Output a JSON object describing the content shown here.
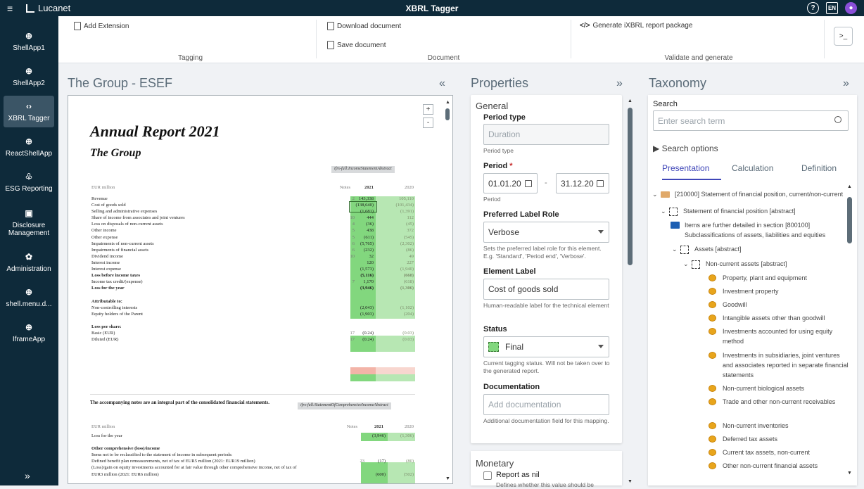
{
  "app": {
    "brand": "Lucanet",
    "title": "XBRL Tagger",
    "help_icon": "?",
    "lang_badge": "EN"
  },
  "sidebar": {
    "items": [
      {
        "label": "ShellApp1",
        "icon": "globe-icon",
        "glyph": "⊕"
      },
      {
        "label": "ShellApp2",
        "icon": "globe-icon",
        "glyph": "⊕"
      },
      {
        "label": "XBRL Tagger",
        "icon": "code-icon",
        "glyph": "‹›"
      },
      {
        "label": "ReactShellApp",
        "icon": "globe-icon",
        "glyph": "⊕"
      },
      {
        "label": "ESG Reporting",
        "icon": "leaf-icon",
        "glyph": "♧"
      },
      {
        "label": "Disclosure Management",
        "icon": "document-icon",
        "glyph": "▣"
      },
      {
        "label": "Administration",
        "icon": "gear-icon",
        "glyph": "✿"
      },
      {
        "label": "shell.menu.d...",
        "icon": "globe-icon",
        "glyph": "⊕"
      },
      {
        "label": "IframeApp",
        "icon": "globe-icon",
        "glyph": "⊕"
      }
    ],
    "active_index": 2,
    "expand_glyph": "»"
  },
  "toolbar": {
    "add_extension": "Add Extension",
    "download_document": "Download document",
    "save_document": "Save document",
    "generate_package": "Generate iXBRL report package",
    "groups": {
      "tagging": "Tagging",
      "document": "Document",
      "validate": "Validate and generate"
    },
    "terminal_glyph": ">_"
  },
  "document_panel": {
    "title": "The Group - ESEF",
    "collapse_glyph": "«",
    "zoom_in": "+",
    "zoom_out": "-",
    "heading": "Annual Report 2021",
    "subheading": "The Group",
    "tag1": "ifrs-full:IncomeStatementAbstract",
    "tag2": "ifrs-full:StatementOfComprehensiveIncomeAbstract",
    "footnote": "The accompanying notes are an integral part of the consolidated financial statements.",
    "table1": {
      "header": {
        "label": "EUR million",
        "notes": "Notes",
        "y1": "2021",
        "y2": "2020"
      },
      "rows": [
        {
          "label": "Revenue",
          "note": "2",
          "v1": "143,338",
          "v2": "105,110",
          "bold": false
        },
        {
          "label": "Cost of goods sold",
          "note": "",
          "v1": "(138,640)",
          "v2": "(101,434)",
          "bold": false
        },
        {
          "label": "Selling and administrative expenses",
          "note": "",
          "v1": "(1,681)",
          "v2": "(1,391)",
          "bold": false
        },
        {
          "label": "Share of income from associates and joint ventures",
          "note": "10",
          "v1": "444",
          "v2": "112",
          "bold": false
        },
        {
          "label": "Loss on disposals of non-current assets",
          "note": "4",
          "v1": "(36)",
          "v2": "(45)",
          "bold": false
        },
        {
          "label": "Other income",
          "note": "5",
          "v1": "438",
          "v2": "372",
          "bold": false
        },
        {
          "label": "Other expense",
          "note": "5",
          "v1": "(611)",
          "v2": "(545)",
          "bold": false
        },
        {
          "label": "Impairments of non-current assets",
          "note": "6",
          "v1": "(5,765)",
          "v2": "(2,302)",
          "bold": false
        },
        {
          "label": "Impairments of financial assets",
          "note": "6",
          "v1": "(232)",
          "v2": "(86)",
          "bold": false
        },
        {
          "label": "Dividend income",
          "note": "10",
          "v1": "32",
          "v2": "49",
          "bold": false
        },
        {
          "label": "Interest income",
          "note": "",
          "v1": "120",
          "v2": "227",
          "bold": false
        },
        {
          "label": "Interest expense",
          "note": "",
          "v1": "(1,573)",
          "v2": "(1,940)",
          "bold": false
        },
        {
          "label": "Loss before income taxes",
          "note": "",
          "v1": "(5,116)",
          "v2": "(668)",
          "bold": true
        },
        {
          "label": "Income tax credit/(expense)",
          "note": "7",
          "v1": "1,170",
          "v2": "(618)",
          "bold": false
        },
        {
          "label": "Loss for the year",
          "note": "",
          "v1": "(3,946)",
          "v2": "(1,306)",
          "bold": true
        },
        {
          "label": "",
          "note": "",
          "v1": "",
          "v2": "",
          "bold": false
        },
        {
          "label": "Attributable to:",
          "note": "",
          "v1": "",
          "v2": "",
          "bold": true
        },
        {
          "label": "Non-controlling interests",
          "note": "",
          "v1": "(2,043)",
          "v2": "(1,102)",
          "bold": false
        },
        {
          "label": "Equity holders of the Parent",
          "note": "",
          "v1": "(1,903)",
          "v2": "(204)",
          "bold": false
        },
        {
          "label": "",
          "note": "",
          "v1": "",
          "v2": "",
          "bold": false
        },
        {
          "label": "Loss per share:",
          "note": "",
          "v1": "",
          "v2": "",
          "bold": true
        },
        {
          "label": "Basic (EUR)",
          "note": "17",
          "v1": "(0.24)",
          "v2": "(0.03)",
          "bold": false
        },
        {
          "label": "Diluted (EUR)",
          "note": "17",
          "v1": "(0.24)",
          "v2": "(0.03)",
          "bold": false
        }
      ]
    },
    "table2": {
      "header": {
        "label": "EUR million",
        "notes": "Notes",
        "y1": "2021",
        "y2": "2020"
      },
      "rows": [
        {
          "label": "Loss for the year",
          "note": "",
          "v1": "(3,946)",
          "v2": "(1,306)",
          "bold": false
        },
        {
          "label": "",
          "note": "",
          "v1": "",
          "v2": "",
          "bold": false
        },
        {
          "label": "Other comprehensive (loss)/income",
          "note": "",
          "v1": "",
          "v2": "",
          "bold": true
        },
        {
          "label": "Items not to be reclassified to the statement of income in subsequent periods:",
          "note": "",
          "v1": "",
          "v2": "",
          "bold": false
        },
        {
          "label": "Defined benefit plan remeasurements, net of tax of EUR5 million (2021: EUR19 million)",
          "note": "23",
          "v1": "(17)",
          "v2": "(80)",
          "bold": false
        },
        {
          "label": "(Loss)/gain on equity investments accounted for at fair value through other comprehensive income, net of tax of",
          "note": "",
          "v1": "",
          "v2": "",
          "bold": false
        },
        {
          "label": "EUR3 million (2021: EUR6 million)",
          "note": "",
          "v1": "(600)",
          "v2": "(502)",
          "bold": false
        }
      ]
    }
  },
  "properties": {
    "title": "Properties",
    "expand_glyph": "»",
    "general": "General",
    "period_type_label": "Period type",
    "period_type_value": "Duration",
    "period_type_hint": "Period type",
    "period_label": "Period",
    "required_mark": "*",
    "period_start": "01.01.20",
    "period_sep": "-",
    "period_end": "31.12.20",
    "period_hint": "Period",
    "plr_label": "Preferred Label Role",
    "plr_value": "Verbose",
    "plr_hint": "Sets the preferred label role for this element. E.g. 'Standard', 'Period end', 'Verbose'.",
    "el_label": "Element Label",
    "el_value": "Cost of goods sold",
    "el_hint": "Human-readable label for the technical element",
    "status_label": "Status",
    "status_value": "Final",
    "status_color": "#82d77e",
    "status_hint": "Current tagging status. Will not be taken over to the generated report.",
    "doc_label": "Documentation",
    "doc_placeholder": "Add documentation",
    "doc_hint": "Additional documentation field for this mapping.",
    "monetary": "Monetary",
    "report_nil": "Report as nil",
    "report_nil_hint": "Defines whether this value should be"
  },
  "taxonomy": {
    "title": "Taxonomy",
    "expand_glyph": "»",
    "search_label": "Search",
    "search_placeholder": "Enter search term",
    "search_options": "Search options",
    "tabs": [
      "Presentation",
      "Calculation",
      "Definition"
    ],
    "active_tab": 0,
    "tree": [
      {
        "text": "[210000] Statement of financial position, current/non-current",
        "icon": "folder-icon"
      },
      {
        "text": "Statement of financial position [abstract]",
        "icon": "abstract-icon"
      },
      {
        "text": "Items are further detailed in section [800100] Subclassifications of assets, liabilities and equities",
        "icon": "link-folder-icon"
      },
      {
        "text": "Assets [abstract]",
        "icon": "abstract-icon"
      },
      {
        "text": "Non-current assets [abstract]",
        "icon": "abstract-icon"
      },
      {
        "text": "Property, plant and equipment",
        "icon": "coins-icon"
      },
      {
        "text": "Investment property",
        "icon": "coins-icon"
      },
      {
        "text": "Goodwill",
        "icon": "coins-icon"
      },
      {
        "text": "Intangible assets other than goodwill",
        "icon": "coins-icon"
      },
      {
        "text": "Investments accounted for using equity method",
        "icon": "coins-icon"
      },
      {
        "text": "Investments in subsidiaries, joint ventures and associates reported in separate financial statements",
        "icon": "coins-icon"
      },
      {
        "text": "Non-current biological assets",
        "icon": "coins-icon"
      },
      {
        "text": "Trade and other non-current receivables",
        "icon": "coins-icon"
      },
      {
        "text": "Non-current inventories",
        "icon": "coins-icon"
      },
      {
        "text": "Deferred tax assets",
        "icon": "coins-icon"
      },
      {
        "text": "Current tax assets, non-current",
        "icon": "coins-icon"
      },
      {
        "text": "Other non-current financial assets",
        "icon": "coins-icon"
      }
    ]
  }
}
